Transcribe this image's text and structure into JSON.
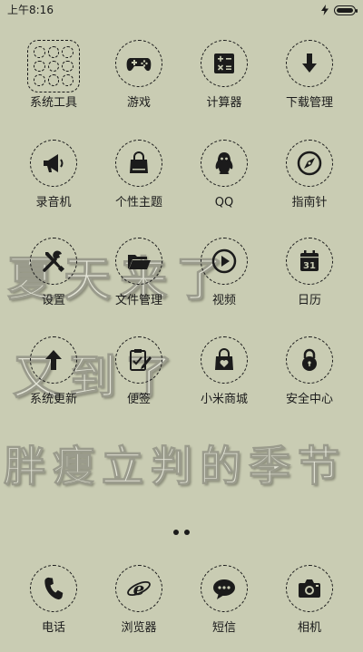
{
  "status_bar": {
    "time": "上午8:16",
    "battery_level": 1.0
  },
  "apps": {
    "row1": [
      "系统工具",
      "游戏",
      "计算器",
      "下载管理"
    ],
    "row2": [
      "录音机",
      "个性主题",
      "QQ",
      "指南针"
    ],
    "row3": [
      "设置",
      "文件管理",
      "视频",
      "日历"
    ],
    "row4": [
      "系统更新",
      "便签",
      "小米商城",
      "安全中心"
    ],
    "dock": [
      "电话",
      "浏览器",
      "短信",
      "相机"
    ]
  },
  "calendar_day": "31",
  "wallpaper_text": {
    "line1": "夏天来了",
    "line2": "又到了",
    "line3": "胖瘦立判的季节"
  },
  "colors": {
    "background": "#c9ccb3",
    "ink": "#1b1b1b"
  },
  "icons": {
    "status_charging": "lightning-icon",
    "status_battery": "battery-icon"
  }
}
